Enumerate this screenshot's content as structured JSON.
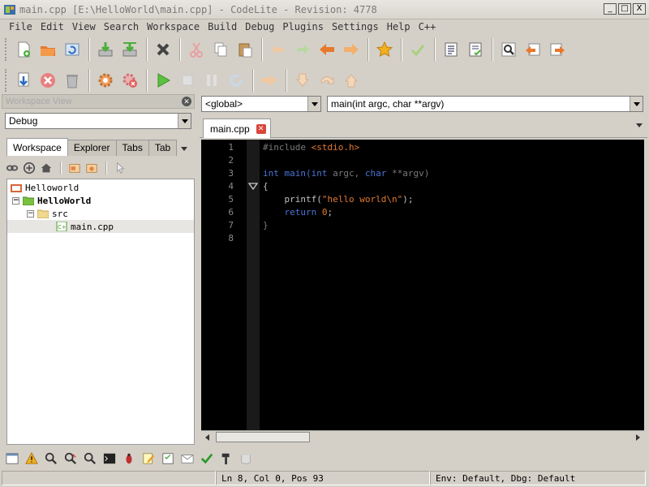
{
  "window": {
    "title": "main.cpp [E:\\HelloWorld\\main.cpp] - CodeLite - Revision: 4778",
    "minimize": "_",
    "maximize": "□",
    "close": "X"
  },
  "menu": [
    "File",
    "Edit",
    "View",
    "Search",
    "Workspace",
    "Build",
    "Debug",
    "Plugins",
    "Settings",
    "Help",
    "C++"
  ],
  "workspace_panel": {
    "header": "Workspace View",
    "config": "Debug",
    "tabs": [
      "Workspace",
      "Explorer",
      "Tabs",
      "Tab"
    ],
    "tree": [
      {
        "label": "Helloworld",
        "level": 0,
        "type": "workspace"
      },
      {
        "label": "HelloWorld",
        "level": 1,
        "type": "project",
        "expander": "−"
      },
      {
        "label": "src",
        "level": 2,
        "type": "folder",
        "expander": "−"
      },
      {
        "label": "main.cpp",
        "level": 3,
        "type": "file"
      }
    ]
  },
  "editor": {
    "scope_combo": "<global>",
    "function_combo": "main(int argc, char **argv)",
    "tab_label": "main.cpp",
    "line_numbers": [
      "1",
      "2",
      "3",
      "4",
      "5",
      "6",
      "7",
      "8"
    ],
    "code": {
      "l1_pre": "#include ",
      "l1_inc": "<stdio.h>",
      "l3_kw1": "int",
      "l3_fn": " main(",
      "l3_kw2": "int",
      "l3_id1": " argc, ",
      "l3_kw3": "char",
      "l3_id2": " **argv)",
      "l4": "{",
      "l5_fn": "    printf(",
      "l5_str": "\"hello world\\n\"",
      "l5_end": ");",
      "l6_kw": "    return",
      "l6_num": " 0",
      "l6_end": ";",
      "l7": "}"
    }
  },
  "status": {
    "position": "Ln 8,  Col 0,  Pos 93",
    "env": "Env: Default, Dbg: Default"
  },
  "colors": {
    "editor_bg": "#000000",
    "keyword": "#4a74d6",
    "string": "#e07a30",
    "chrome": "#d4d0c8"
  }
}
